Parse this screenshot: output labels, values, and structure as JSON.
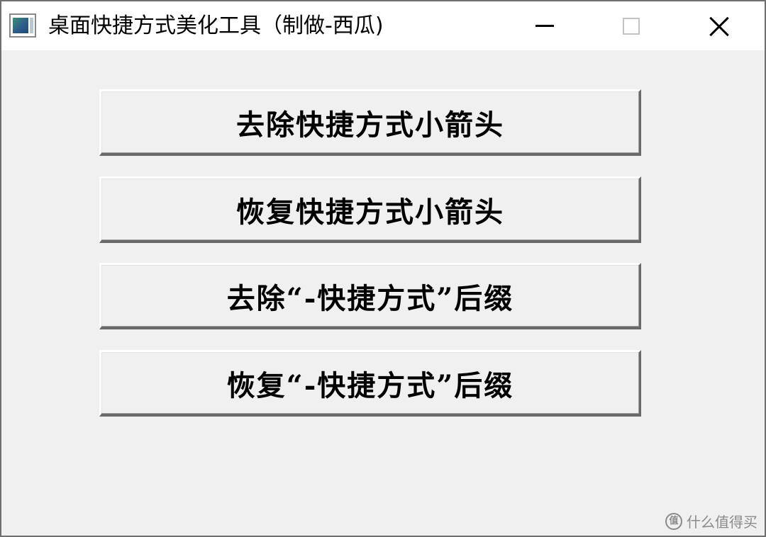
{
  "window": {
    "title": "桌面快捷方式美化工具（制做-西瓜)"
  },
  "icons": {
    "app": "app-icon",
    "minimize": "minimize-icon",
    "maximize": "maximize-icon",
    "close": "close-icon"
  },
  "buttons": [
    {
      "label": "去除快捷方式小箭头"
    },
    {
      "label": "恢复快捷方式小箭头"
    },
    {
      "label": "去除“-快捷方式”后缀"
    },
    {
      "label": "恢复“-快捷方式”后缀"
    }
  ],
  "watermark": {
    "badge": "值",
    "text": "什么值得买"
  },
  "colors": {
    "client_bg": "#f0f0f0",
    "titlebar_bg": "#ffffff",
    "text": "#000000"
  }
}
